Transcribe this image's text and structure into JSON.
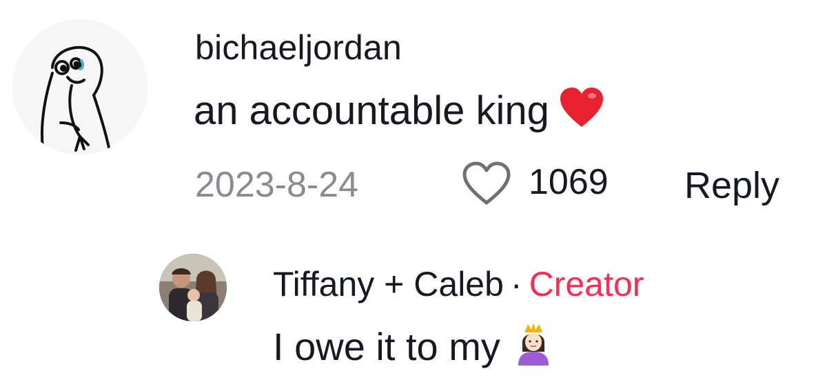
{
  "comments": [
    {
      "username": "bichaeljordan",
      "text": "an accountable king",
      "emoji": "red-heart-icon",
      "date": "2023-8-24",
      "likes": "1069",
      "reply_label": "Reply"
    }
  ],
  "replies": [
    {
      "username": "Tiffany + Caleb",
      "separator": "·",
      "creator_badge": "Creator",
      "text": "I owe it to my",
      "emoji": "princess-icon"
    }
  ],
  "colors": {
    "text": "#161823",
    "muted": "#8a8b91",
    "creator": "#fe2c55",
    "heart": "#e8202f"
  }
}
